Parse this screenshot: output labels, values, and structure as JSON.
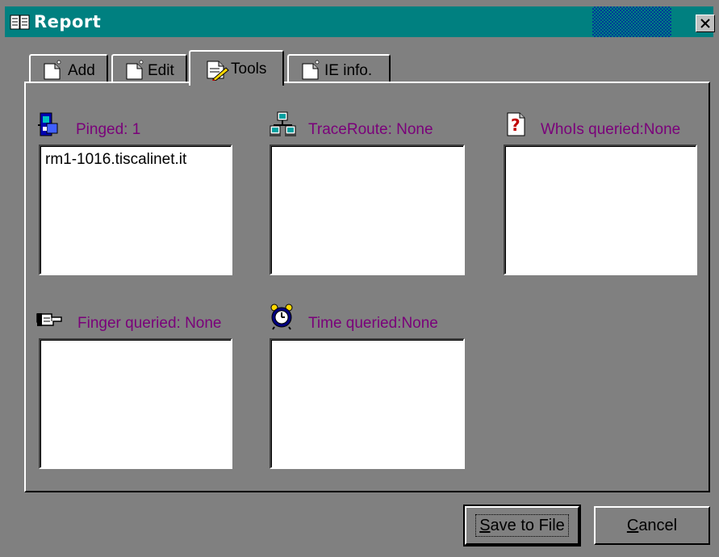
{
  "window": {
    "title": "Report"
  },
  "tabs": [
    {
      "label": "Add",
      "active": false
    },
    {
      "label": "Edit",
      "active": false
    },
    {
      "label": "Tools",
      "active": true
    },
    {
      "label": "IE info.",
      "active": false
    }
  ],
  "sections": {
    "ping": {
      "label": "Pinged: 1",
      "items": [
        "rm1-1016.tiscalinet.it"
      ],
      "icon": "ping-icon"
    },
    "traceroute": {
      "label": "TraceRoute: None",
      "items": [],
      "icon": "network-icon"
    },
    "whois": {
      "label": "WhoIs queried:None",
      "items": [],
      "icon": "whois-question-icon"
    },
    "finger": {
      "label": "Finger queried: None",
      "items": [],
      "icon": "pointing-hand-icon"
    },
    "time": {
      "label": "Time queried:None",
      "items": [],
      "icon": "alarm-clock-icon"
    }
  },
  "buttons": {
    "save_mnemonic": "S",
    "save_rest": "ave to File",
    "cancel_mnemonic": "C",
    "cancel_rest": "ancel"
  },
  "colors": {
    "titlebar": "#008080",
    "label_text": "#7a007a",
    "dialog_bg": "#808080"
  }
}
